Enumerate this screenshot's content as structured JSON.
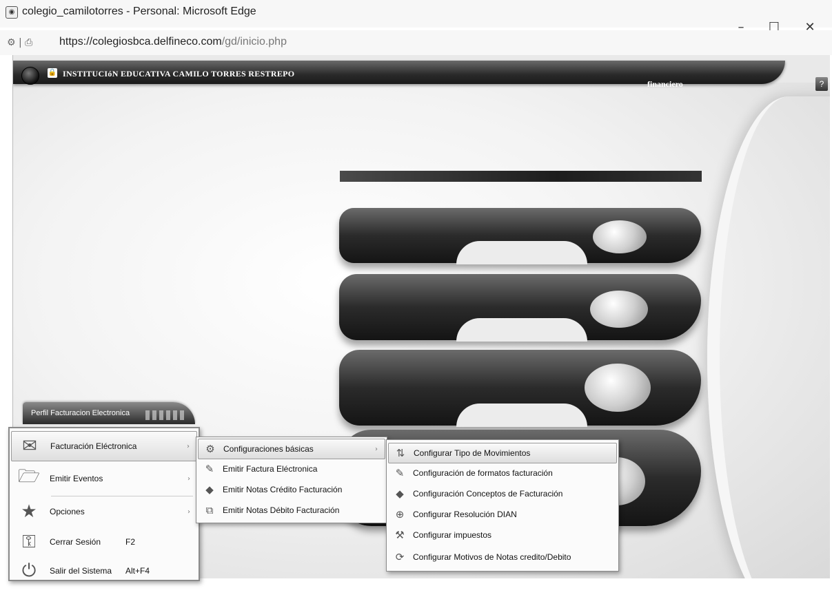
{
  "window": {
    "title": "colegio_camilotorres - Personal: Microsoft Edge",
    "minimize": "–",
    "maximize": "☐",
    "close": "✕"
  },
  "address": {
    "url_host": "https://colegiosbca.delfineco.com",
    "url_path": "/gd/inicio.php"
  },
  "app": {
    "institution": "INSTITUCIóN EDUCATIVA CAMILO TORRES RESTREPO",
    "user": "financiero",
    "help": "?",
    "profile_tab": "Perfil Facturacion Electronica"
  },
  "main_menu": [
    {
      "label": "Facturación Eléctronica",
      "icon": "envelope-icon",
      "submenu": true,
      "shortcut": ""
    },
    {
      "label": "Emitir Eventos",
      "icon": "folder-icon",
      "submenu": true,
      "shortcut": ""
    },
    {
      "label": "Opciones",
      "icon": "star-icon",
      "submenu": true,
      "shortcut": ""
    },
    {
      "label": "Cerrar Sesión",
      "icon": "keys-icon",
      "submenu": false,
      "shortcut": "F2"
    },
    {
      "label": "Salir del Sistema",
      "icon": "power-icon",
      "submenu": false,
      "shortcut": "Alt+F4"
    }
  ],
  "submenu_facturacion": [
    {
      "label": "Configuraciones básicas",
      "icon": "gear-document-icon",
      "submenu": true
    },
    {
      "label": "Emitir Factura Eléctronica",
      "icon": "pencil-icon",
      "submenu": false
    },
    {
      "label": "Emitir Notas Crédito Facturación",
      "icon": "tag-icon",
      "submenu": false
    },
    {
      "label": "Emitir Notas Débito Facturación",
      "icon": "copy-document-icon",
      "submenu": false
    }
  ],
  "submenu_configuraciones": [
    {
      "label": "Configurar Tipo de Movimientos",
      "icon": "movements-icon"
    },
    {
      "label": "Configuración de formatos facturación",
      "icon": "pencil-icon"
    },
    {
      "label": "Configuración Conceptos de Facturación",
      "icon": "tag-icon"
    },
    {
      "label": "Configurar Resolución DIAN",
      "icon": "circle-plus-icon"
    },
    {
      "label": "Configurar impuestos",
      "icon": "wrench-icon"
    },
    {
      "label": "Configurar Motivos de Notas credito/Debito",
      "icon": "notes-icon"
    }
  ]
}
